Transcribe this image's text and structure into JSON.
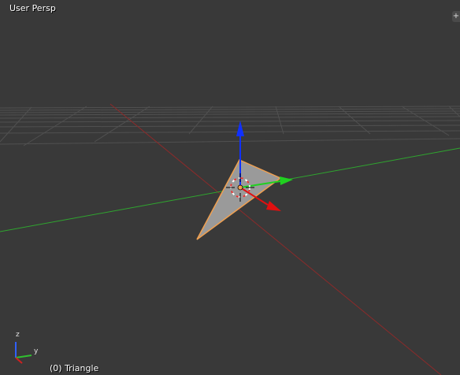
{
  "viewport": {
    "view_label": "User Persp",
    "object_label": "(0) Triangle",
    "corner_widget_symbol": "+",
    "background_color": "#393939"
  },
  "scene": {
    "grid_color": "#555555",
    "x_axis_color": "#8c2a2a",
    "y_axis_color": "#2fa52f",
    "triangle_fill": "#9a9a9a",
    "triangle_outline": "#f0a050",
    "cursor_color": "#ffffff",
    "cursor_accent": "#e03030"
  },
  "gizmo": {
    "z_color": "#1030ff",
    "y_color": "#20d020",
    "x_color": "#e01010"
  },
  "mini_axes": {
    "z_label": "z",
    "y_label": "y",
    "z_color": "#3060ff",
    "y_color": "#30c030",
    "x_color": "#d02020"
  }
}
